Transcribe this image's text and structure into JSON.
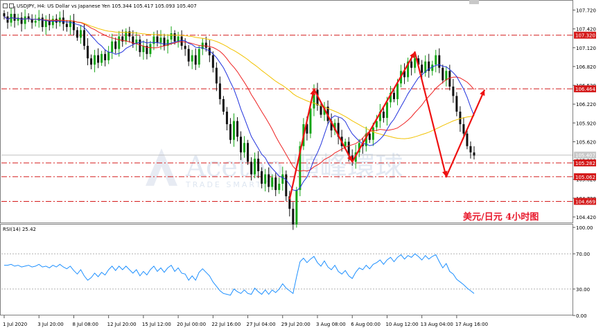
{
  "header": {
    "symbol_text": "USDJPY, H4:  US Dollar vs Japanese Yen  105.344 105.417 105.093 105.407"
  },
  "rsi_header": {
    "text": "RSI(14) 25.42"
  },
  "annotation": {
    "text": "美元/日元  4小时图",
    "color": "#e8192c"
  },
  "watermark": {
    "main": "Acetop 順峰環球",
    "sub": "TRADE SMARTER"
  },
  "colors": {
    "bull": "#15a515",
    "bear": "#111111",
    "ma_fast": "#2233dd",
    "ma_mid": "#ee2222",
    "ma_slow": "#f2c200",
    "arrow": "#ee1111",
    "rsi": "#1e90ff",
    "hline": "#d41a1a"
  },
  "chart_data": [
    {
      "type": "candlestick",
      "title": "USDJPY, H4",
      "ylim": [
        104.32,
        107.87
      ],
      "y_ticks": [
        "107.720",
        "107.420",
        "107.120",
        "106.820",
        "106.520",
        "106.220",
        "105.920",
        "105.620",
        "105.320",
        "105.020",
        "104.720",
        "104.420"
      ],
      "x_labels": [
        "1 Jul 2020",
        "3 Jul 20:00",
        "8 Jul 08:00",
        "12 Jul 20:00",
        "15 Jul 12:00",
        "20 Jul 00:00",
        "22 Jul 16:00",
        "27 Jul 04:00",
        "29 Jul 20:00",
        "3 Aug 08:00",
        "6 Aug 00:00",
        "10 Aug 12:00",
        "13 Aug 04:00",
        "17 Aug 16:00"
      ],
      "x_label_index": [
        0,
        10,
        20,
        30,
        40,
        50,
        60,
        70,
        80,
        90,
        100,
        110,
        120,
        130
      ],
      "horizontal_levels": [
        {
          "value": 107.32,
          "label": "107.320"
        },
        {
          "value": 106.464,
          "label": "106.464"
        },
        {
          "value": 105.282,
          "label": "105.282"
        },
        {
          "value": 105.062,
          "label": "105.062"
        },
        {
          "value": 104.669,
          "label": "104.669"
        }
      ],
      "last_price": "105.407",
      "closes": [
        107.62,
        107.52,
        107.66,
        107.55,
        107.6,
        107.5,
        107.62,
        107.58,
        107.52,
        107.55,
        107.6,
        107.45,
        107.55,
        107.48,
        107.58,
        107.52,
        107.6,
        107.5,
        107.45,
        107.55,
        107.4,
        107.28,
        107.4,
        107.15,
        106.95,
        106.85,
        107.0,
        106.88,
        107.02,
        106.92,
        107.05,
        107.22,
        107.1,
        107.3,
        107.22,
        107.38,
        107.3,
        107.18,
        107.25,
        107.05,
        107.15,
        107.02,
        107.18,
        107.3,
        107.2,
        107.28,
        107.15,
        107.25,
        107.35,
        107.22,
        107.3,
        107.15,
        107.1,
        106.9,
        107.0,
        106.85,
        107.1,
        107.2,
        107.12,
        107.0,
        106.8,
        106.55,
        106.3,
        106.1,
        105.9,
        105.65,
        105.95,
        105.7,
        105.45,
        105.6,
        105.3,
        105.1,
        105.35,
        105.15,
        104.95,
        105.1,
        104.9,
        105.05,
        104.85,
        104.95,
        105.1,
        104.75,
        104.55,
        104.3,
        104.85,
        105.55,
        105.9,
        105.75,
        106.15,
        106.45,
        106.2,
        106.05,
        106.18,
        105.95,
        105.8,
        105.92,
        105.7,
        105.55,
        105.62,
        105.4,
        105.3,
        105.45,
        105.6,
        105.55,
        105.75,
        105.65,
        105.85,
        105.95,
        106.1,
        106.0,
        106.25,
        106.4,
        106.3,
        106.55,
        106.75,
        106.65,
        106.9,
        106.8,
        106.95,
        106.85,
        106.72,
        106.9,
        106.75,
        106.85,
        107.0,
        106.8,
        106.6,
        106.75,
        106.5,
        106.35,
        106.1,
        105.9,
        105.75,
        105.55,
        105.45,
        105.4
      ],
      "ma_fast_period": 10,
      "ma_mid_period": 21,
      "ma_slow_period": 55,
      "arrow_path_values": [
        [
          82,
          104.7
        ],
        [
          89,
          106.46
        ],
        [
          100,
          105.3
        ],
        [
          118,
          107.05
        ],
        [
          127,
          105.06
        ],
        [
          138,
          106.45
        ]
      ]
    },
    {
      "type": "line",
      "title": "RSI(14) 25.42",
      "ylim": [
        0,
        100
      ],
      "y_ticks": [
        "100.00",
        "70.00",
        "30.00",
        "0.00"
      ],
      "levels": [
        70,
        30
      ],
      "values": [
        57,
        57,
        58,
        56,
        57,
        55,
        56,
        57,
        55,
        56,
        58,
        55,
        56,
        54,
        57,
        55,
        58,
        55,
        53,
        56,
        51,
        47,
        52,
        45,
        40,
        43,
        48,
        44,
        49,
        46,
        52,
        56,
        51,
        56,
        52,
        56,
        52,
        48,
        52,
        45,
        50,
        46,
        52,
        56,
        50,
        54,
        49,
        54,
        57,
        50,
        54,
        48,
        47,
        40,
        45,
        40,
        49,
        53,
        49,
        45,
        38,
        33,
        28,
        25,
        24,
        23,
        30,
        27,
        25,
        29,
        25,
        24,
        31,
        27,
        24,
        29,
        24,
        29,
        26,
        30,
        36,
        31,
        28,
        25,
        44,
        61,
        65,
        60,
        64,
        67,
        60,
        56,
        62,
        55,
        52,
        57,
        50,
        47,
        51,
        45,
        42,
        49,
        54,
        52,
        57,
        53,
        58,
        60,
        63,
        58,
        63,
        66,
        61,
        66,
        69,
        64,
        68,
        66,
        70,
        67,
        63,
        68,
        64,
        67,
        69,
        61,
        54,
        59,
        50,
        47,
        41,
        38,
        35,
        31,
        28,
        25
      ]
    }
  ]
}
